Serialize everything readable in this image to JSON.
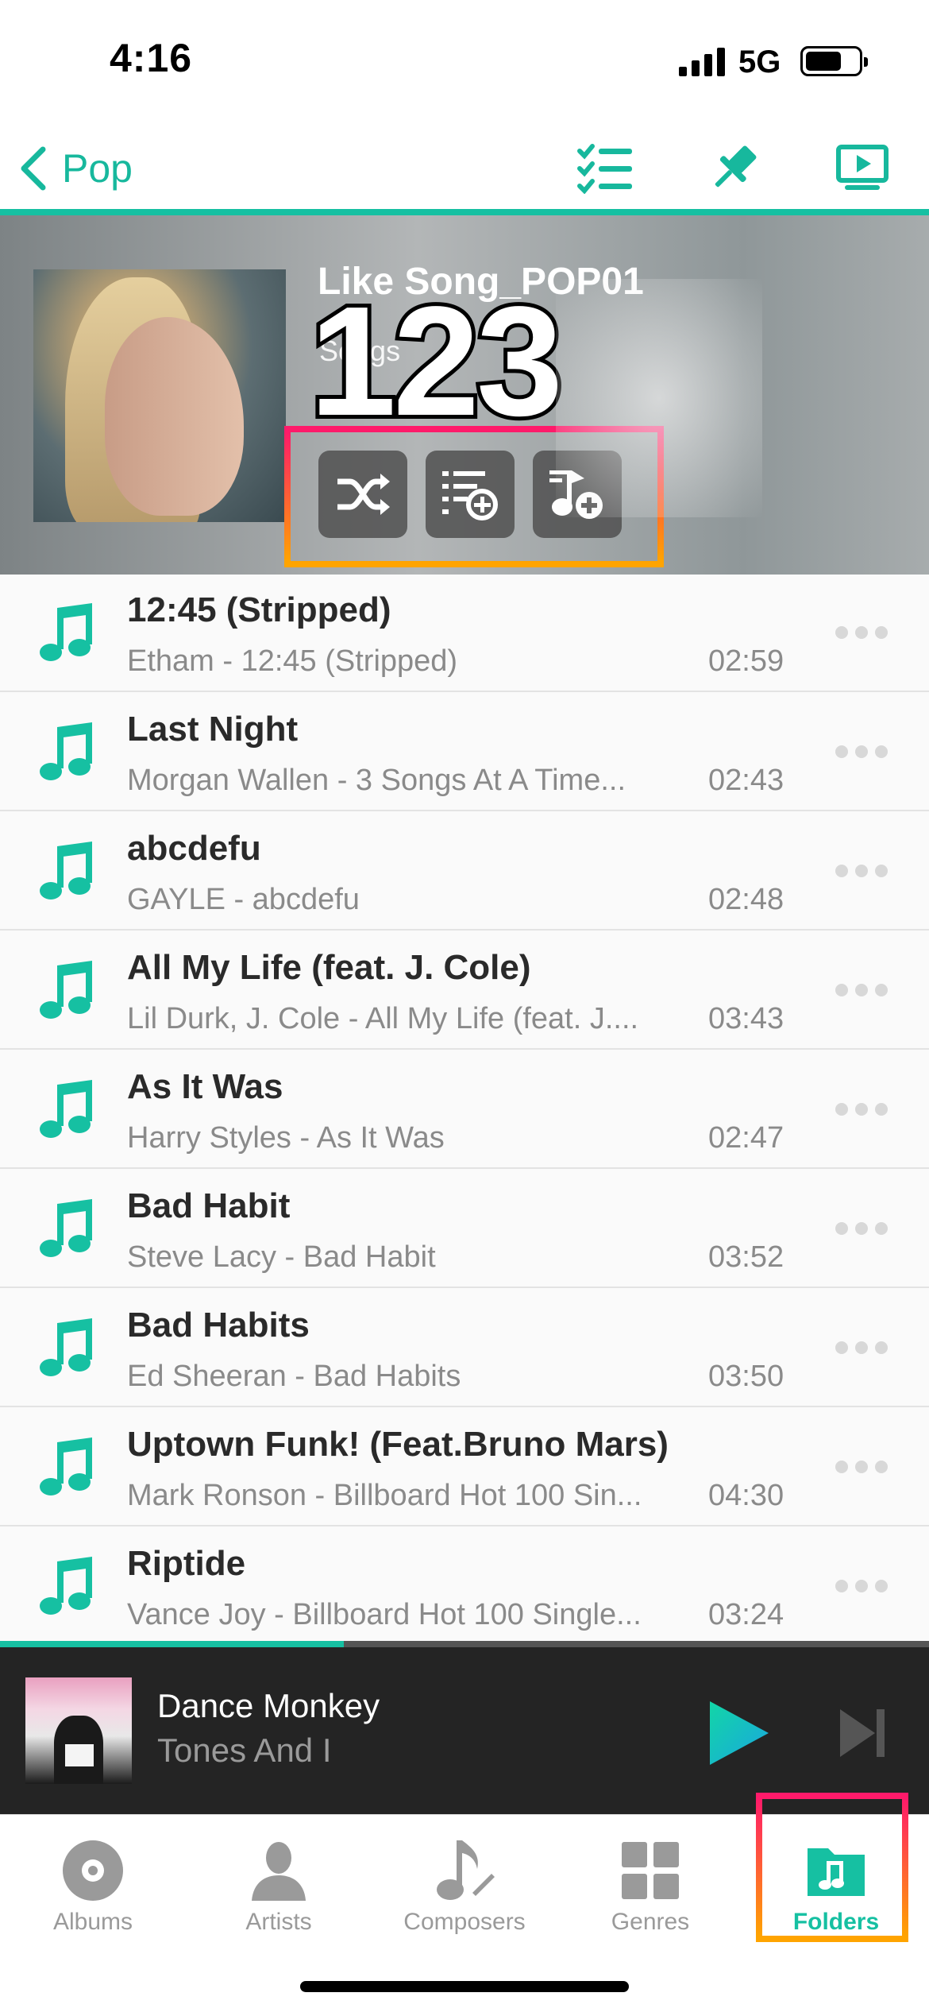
{
  "status_bar": {
    "time": "4:16",
    "network": "5G"
  },
  "nav": {
    "back_label": "Pop"
  },
  "header": {
    "playlist_title": "Like Song_POP01",
    "subtitle": "Songs",
    "count_overlay": "123",
    "actions": [
      "shuffle-icon",
      "add-to-queue-icon",
      "add-song-icon"
    ]
  },
  "songs": [
    {
      "title": "12:45 (Stripped)",
      "subtitle": "Etham - 12:45 (Stripped)",
      "duration": "02:59"
    },
    {
      "title": "Last Night",
      "subtitle": "Morgan Wallen - 3 Songs At A Time...",
      "duration": "02:43"
    },
    {
      "title": "abcdefu",
      "subtitle": "GAYLE - abcdefu",
      "duration": "02:48"
    },
    {
      "title": "All My Life (feat. J. Cole)",
      "subtitle": "Lil Durk, J. Cole - All My Life (feat. J....",
      "duration": "03:43"
    },
    {
      "title": "As It Was",
      "subtitle": "Harry Styles - As It Was",
      "duration": "02:47"
    },
    {
      "title": "Bad Habit",
      "subtitle": "Steve Lacy - Bad Habit",
      "duration": "03:52"
    },
    {
      "title": "Bad Habits",
      "subtitle": "Ed Sheeran - Bad Habits",
      "duration": "03:50"
    },
    {
      "title": "Uptown Funk! (Feat.Bruno Mars)",
      "subtitle": "Mark Ronson - Billboard Hot 100 Sin...",
      "duration": "04:30"
    },
    {
      "title": "Riptide",
      "subtitle": "Vance Joy - Billboard Hot 100 Single...",
      "duration": "03:24"
    }
  ],
  "now_playing": {
    "title": "Dance Monkey",
    "artist": "Tones And I",
    "progress": 0.37
  },
  "tabs": [
    {
      "label": "Albums",
      "icon": "album-icon",
      "active": false
    },
    {
      "label": "Artists",
      "icon": "person-icon",
      "active": false
    },
    {
      "label": "Composers",
      "icon": "composer-icon",
      "active": false
    },
    {
      "label": "Genres",
      "icon": "grid-icon",
      "active": false
    },
    {
      "label": "Folders",
      "icon": "music-folder-icon",
      "active": true
    }
  ],
  "colors": {
    "accent": "#16c0a2",
    "highlight_top": "#ff1a6a",
    "highlight_bottom": "#ffa400"
  }
}
